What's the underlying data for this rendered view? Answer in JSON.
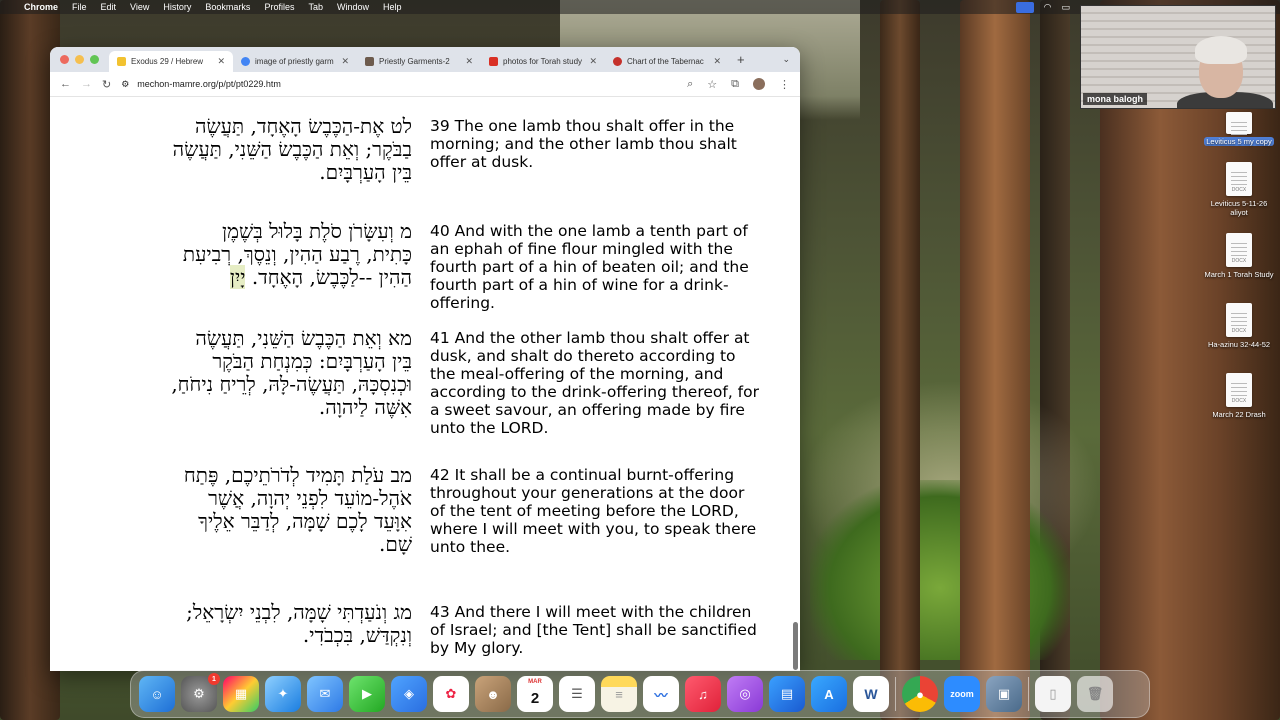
{
  "menubar": {
    "apple": "",
    "app": "Chrome",
    "items": [
      "File",
      "Edit",
      "View",
      "History",
      "Bookmarks",
      "Profiles",
      "Tab",
      "Window",
      "Help"
    ]
  },
  "browser": {
    "tabs": [
      {
        "title": "Exodus 29 / Hebrew",
        "favicon_color": "#f2c230",
        "active": true
      },
      {
        "title": "image of priestly garm",
        "favicon_color": "#4285f4",
        "active": false
      },
      {
        "title": "Priestly Garments-2",
        "favicon_color": "#6d5b4d",
        "active": false
      },
      {
        "title": "photos for Torah study",
        "favicon_color": "#d93025",
        "active": false
      },
      {
        "title": "Chart of the Tabernac",
        "favicon_color": "#c5312b",
        "active": false
      }
    ],
    "url": "mechon-mamre.org/p/pt/pt0229.htm"
  },
  "verses": [
    {
      "hebrew_lines": [
        "לט  אֶת-הַכֶּבֶשׂ הָאֶחָד, תַּעֲשֶׂה",
        "בַבֹּקֶר; וְאֵת הַכֶּבֶשׂ הַשֵּׁנִי, תַּעֲשֶׂה",
        "בֵּין הָעַרְבָּיִם."
      ],
      "english": "39 The one lamb thou shalt offer in the morning; and the other lamb thou shalt offer at dusk."
    },
    {
      "hebrew_lines": [
        "מ  וְעִשָּׂרֹן סֹלֶת בָּלוּל בְּשֶׁמֶן",
        "כָּתִית, רֶבַע הַהִין, וְנֵסֶךְ, רְבִיעִת",
        "הַהִין --לַכֶּבֶשׂ, הָאֶחָד."
      ],
      "hebrew_highlight": "יָיִן",
      "english": "40 And with the one lamb a tenth part of an ephah of fine flour mingled with the fourth part of a hin of beaten oil; and the fourth part of a hin of wine for a drink-offering."
    },
    {
      "hebrew_lines": [
        "מא  וְאֵת הַכֶּבֶשׂ הַשֵּׁנִי, תַּעֲשֶׂה",
        "בֵּין הָעַרְבָּיִם:  כְּמִנְחַת הַבֹּקֶר",
        "וּכְנִסְכָּהּ, תַּעֲשֶׂה-לָּהּ, לְרֵיחַ נִיחֹחַ,",
        "אִשֶּׁה לַיהוָה."
      ],
      "english": "41 And the other lamb thou shalt offer at dusk, and shalt do thereto according to the meal-offering of the morning, and according to the drink-offering thereof, for a sweet savour, an offering made by fire unto the LORD."
    },
    {
      "hebrew_lines": [
        "מב  עֹלַת תָּמִיד לְדֹרֹתֵיכֶם, פֶּתַח",
        "אֹהֶל-מוֹעֵד לִפְנֵי יְהוָה, אֲשֶׁר",
        "אִוָּעֵד לָכֶם שָׁמָּה, לְדַבֵּר אֵלֶיךָ",
        "שָׁם."
      ],
      "english": "42 It shall be a continual burnt-offering throughout your generations at the door of the tent of meeting before the LORD, where I will meet with you, to speak there unto thee."
    },
    {
      "hebrew_lines": [
        "מג  וְנֹעַדְתִּי שָׁמָּה, לִבְנֵי יִשְׂרָאֵל;",
        "וְנִקְדַּשׁ, בִּכְבֹדִי."
      ],
      "english": "43 And there I will meet with the children of Israel; and [the Tent] shall be sanctified by My glory."
    }
  ],
  "zoom": {
    "participant_name": "mona balogh"
  },
  "desktop_files": [
    {
      "label": "Leviticus 5 my copy",
      "tag": "",
      "highlighted": true
    },
    {
      "label": "Leviticus 5-11-26 aliyot",
      "tag": "DOCX"
    },
    {
      "label": "March 1 Torah Study",
      "tag": "DOCX"
    },
    {
      "label": "Ha-azinu 32-44-52",
      "tag": "DOCX"
    },
    {
      "label": "March 22 Drash",
      "tag": "DOCX"
    }
  ],
  "dock": {
    "calendar_month": "MAR",
    "calendar_day": "2",
    "settings_badge": "1",
    "zoom_label": "zoom",
    "word_label": "W"
  }
}
